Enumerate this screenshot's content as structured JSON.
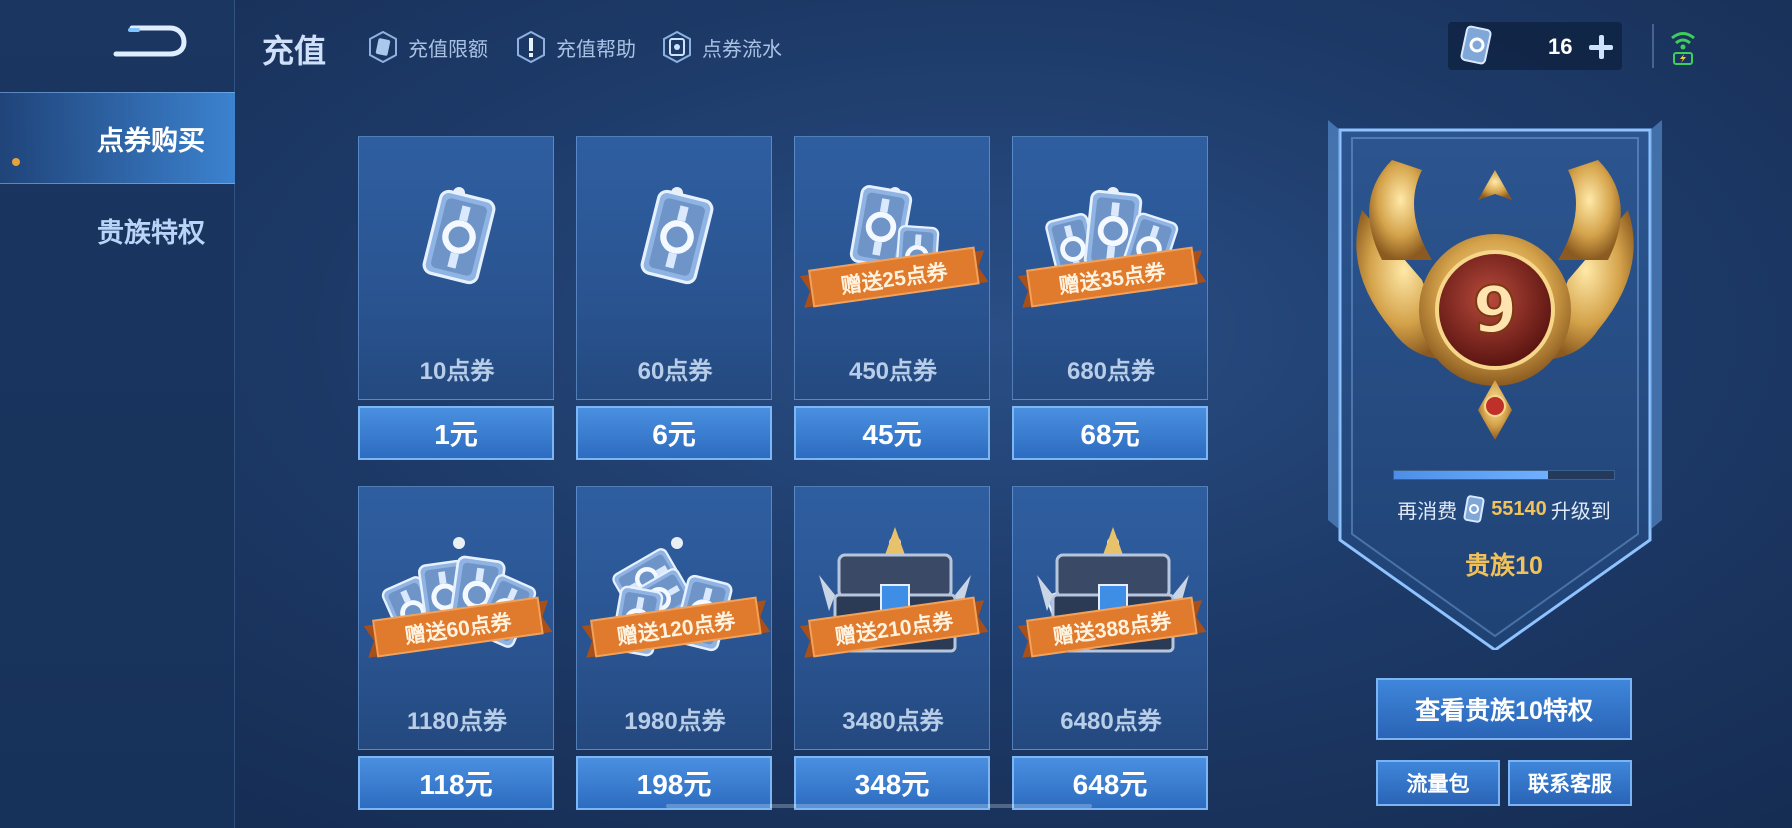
{
  "header": {
    "title": "充值",
    "links": [
      {
        "label": "充值限额",
        "icon": "coupon-card-icon"
      },
      {
        "label": "充值帮助",
        "icon": "exclamation-icon"
      },
      {
        "label": "点券流水",
        "icon": "coupon-log-icon"
      }
    ],
    "balance": "16",
    "signal_icon": "wifi-battery-icon"
  },
  "sidebar": {
    "items": [
      {
        "label": "点券购买",
        "active": true
      },
      {
        "label": "贵族特权",
        "active": false
      }
    ]
  },
  "products": [
    {
      "amount": "10点券",
      "price": "1元",
      "bonus": "",
      "art": "single-coupon"
    },
    {
      "amount": "60点券",
      "price": "6元",
      "bonus": "",
      "art": "single-coupon"
    },
    {
      "amount": "450点券",
      "price": "45元",
      "bonus": "赠送25点券",
      "art": "double-coupon"
    },
    {
      "amount": "680点券",
      "price": "68元",
      "bonus": "赠送35点券",
      "art": "triple-coupon"
    },
    {
      "amount": "1180点券",
      "price": "118元",
      "bonus": "赠送60点券",
      "art": "fan-coupon"
    },
    {
      "amount": "1980点券",
      "price": "198元",
      "bonus": "赠送120点券",
      "art": "stack-coupon"
    },
    {
      "amount": "3480点券",
      "price": "348元",
      "bonus": "赠送210点券",
      "art": "chest"
    },
    {
      "amount": "6480点券",
      "price": "648元",
      "bonus": "赠送388点券",
      "art": "chest-coupon"
    }
  ],
  "noble": {
    "level": "9",
    "progress": 0.7,
    "prefix": "再消费",
    "remaining": "55140",
    "suffix": "升级到",
    "next_level": "贵族10",
    "view_button": "查看贵族10特权",
    "data_pack_button": "流量包",
    "support_button": "联系客服"
  },
  "colors": {
    "accent_gold": "#f2c25a",
    "ribbon_orange": "#e07a2c",
    "button_blue": "#3f86da"
  }
}
